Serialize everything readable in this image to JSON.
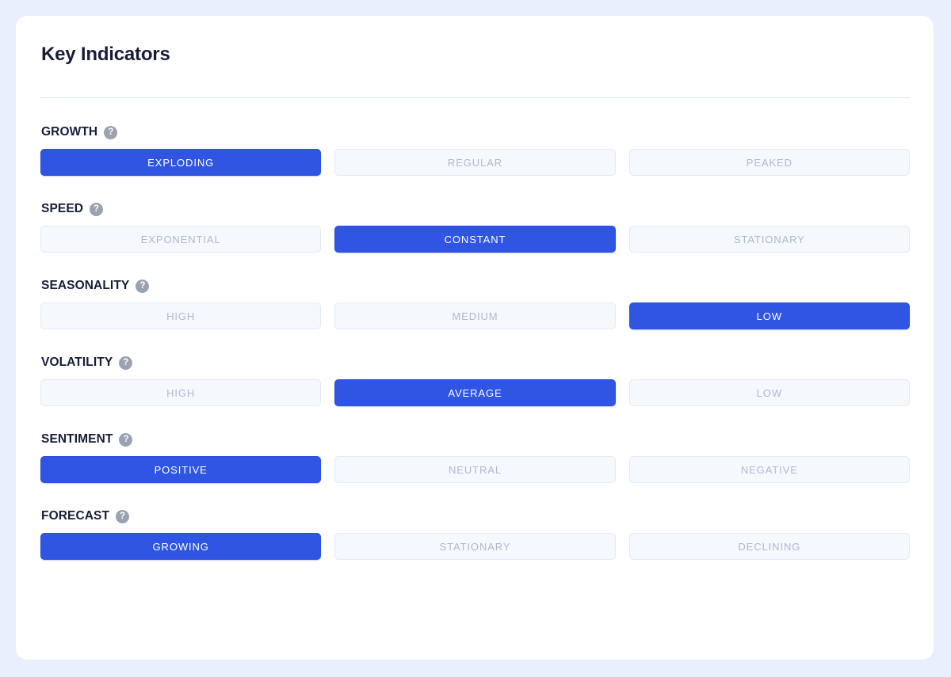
{
  "card": {
    "title": "Key Indicators"
  },
  "help_icon_glyph": "?",
  "colors": {
    "page_background": "#e9effc",
    "card_background": "#ffffff",
    "accent_active": "#3055e3",
    "inactive_background": "#f5f8fd",
    "inactive_border": "#e3ebf7",
    "inactive_text": "#aeb9d1",
    "title_text": "#161d37",
    "divider": "#dde7f4",
    "help_icon": "#9aa2b1"
  },
  "indicators": [
    {
      "label": "GROWTH",
      "help": "?",
      "options": [
        {
          "label": "EXPLODING",
          "selected": true
        },
        {
          "label": "REGULAR",
          "selected": false
        },
        {
          "label": "PEAKED",
          "selected": false
        }
      ]
    },
    {
      "label": "SPEED",
      "help": "?",
      "options": [
        {
          "label": "EXPONENTIAL",
          "selected": false
        },
        {
          "label": "CONSTANT",
          "selected": true
        },
        {
          "label": "STATIONARY",
          "selected": false
        }
      ]
    },
    {
      "label": "SEASONALITY",
      "help": "?",
      "options": [
        {
          "label": "HIGH",
          "selected": false
        },
        {
          "label": "MEDIUM",
          "selected": false
        },
        {
          "label": "LOW",
          "selected": true
        }
      ]
    },
    {
      "label": "VOLATILITY",
      "help": "?",
      "options": [
        {
          "label": "HIGH",
          "selected": false
        },
        {
          "label": "AVERAGE",
          "selected": true
        },
        {
          "label": "LOW",
          "selected": false
        }
      ]
    },
    {
      "label": "SENTIMENT",
      "help": "?",
      "options": [
        {
          "label": "POSITIVE",
          "selected": true
        },
        {
          "label": "NEUTRAL",
          "selected": false
        },
        {
          "label": "NEGATIVE",
          "selected": false
        }
      ]
    },
    {
      "label": "FORECAST",
      "help": "?",
      "options": [
        {
          "label": "GROWING",
          "selected": true
        },
        {
          "label": "STATIONARY",
          "selected": false
        },
        {
          "label": "DECLINING",
          "selected": false
        }
      ]
    }
  ]
}
